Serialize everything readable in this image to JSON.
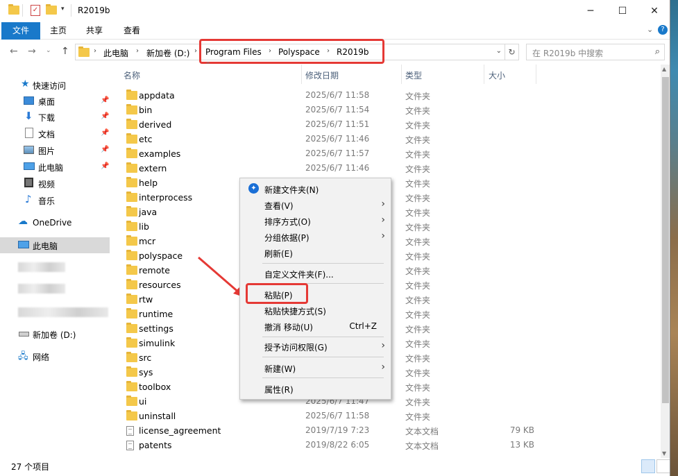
{
  "window": {
    "title": "R2019b",
    "controls": {
      "minimize": "─",
      "maximize": "☐",
      "close": "✕"
    }
  },
  "ribbon": {
    "tabs": [
      "文件",
      "主页",
      "共享",
      "查看"
    ]
  },
  "address": {
    "crumbs": [
      "此电脑",
      "新加卷 (D:)",
      "Program Files",
      "Polyspace",
      "R2019b"
    ],
    "search_placeholder": "在 R2019b 中搜索"
  },
  "nav": {
    "quick_access": "快速访问",
    "quick_items": [
      "桌面",
      "下载",
      "文档",
      "图片",
      "此电脑",
      "视频",
      "音乐"
    ],
    "onedrive": "OneDrive",
    "this_pc": "此电脑",
    "drive": "新加卷 (D:)",
    "network": "网络"
  },
  "columns": {
    "name": "名称",
    "date": "修改日期",
    "type": "类型",
    "size": "大小"
  },
  "files": [
    {
      "name": "appdata",
      "date": "2025/6/7 11:58",
      "type": "文件夹",
      "size": ""
    },
    {
      "name": "bin",
      "date": "2025/6/7 11:54",
      "type": "文件夹",
      "size": ""
    },
    {
      "name": "derived",
      "date": "2025/6/7 11:51",
      "type": "文件夹",
      "size": ""
    },
    {
      "name": "etc",
      "date": "2025/6/7 11:46",
      "type": "文件夹",
      "size": ""
    },
    {
      "name": "examples",
      "date": "2025/6/7 11:57",
      "type": "文件夹",
      "size": ""
    },
    {
      "name": "extern",
      "date": "2025/6/7 11:46",
      "type": "文件夹",
      "size": ""
    },
    {
      "name": "help",
      "date": "",
      "type": "文件夹",
      "size": ""
    },
    {
      "name": "interprocess",
      "date": "",
      "type": "文件夹",
      "size": ""
    },
    {
      "name": "java",
      "date": "",
      "type": "文件夹",
      "size": ""
    },
    {
      "name": "lib",
      "date": "",
      "type": "文件夹",
      "size": ""
    },
    {
      "name": "mcr",
      "date": "",
      "type": "文件夹",
      "size": ""
    },
    {
      "name": "polyspace",
      "date": "",
      "type": "文件夹",
      "size": ""
    },
    {
      "name": "remote",
      "date": "",
      "type": "文件夹",
      "size": ""
    },
    {
      "name": "resources",
      "date": "",
      "type": "文件夹",
      "size": ""
    },
    {
      "name": "rtw",
      "date": "",
      "type": "文件夹",
      "size": ""
    },
    {
      "name": "runtime",
      "date": "",
      "type": "文件夹",
      "size": ""
    },
    {
      "name": "settings",
      "date": "",
      "type": "文件夹",
      "size": ""
    },
    {
      "name": "simulink",
      "date": "",
      "type": "文件夹",
      "size": ""
    },
    {
      "name": "src",
      "date": "",
      "type": "文件夹",
      "size": ""
    },
    {
      "name": "sys",
      "date": "",
      "type": "文件夹",
      "size": ""
    },
    {
      "name": "toolbox",
      "date": "",
      "type": "文件夹",
      "size": ""
    },
    {
      "name": "ui",
      "date": "2025/6/7 11:47",
      "type": "文件夹",
      "size": ""
    },
    {
      "name": "uninstall",
      "date": "2025/6/7 11:58",
      "type": "文件夹",
      "size": ""
    },
    {
      "name": "license_agreement",
      "date": "2019/7/19 7:23",
      "type": "文本文档",
      "size": "79 KB"
    },
    {
      "name": "patents",
      "date": "2019/8/22 6:05",
      "type": "文本文档",
      "size": "13 KB"
    }
  ],
  "status": {
    "count": "27 个项目"
  },
  "context_menu": {
    "new_folder": "新建文件夹(N)",
    "view": "查看(V)",
    "sort": "排序方式(O)",
    "group": "分组依据(P)",
    "refresh": "刷新(E)",
    "customize": "自定义文件夹(F)...",
    "paste": "粘贴(P)",
    "paste_shortcut": "粘贴快捷方式(S)",
    "undo": "撤消 移动(U)",
    "undo_shortcut": "Ctrl+Z",
    "grant_access": "授予访问权限(G)",
    "new": "新建(W)",
    "properties": "属性(R)"
  },
  "colors": {
    "accent": "#1979ca",
    "highlight": "#e53935",
    "folder": "#f4c84a"
  }
}
